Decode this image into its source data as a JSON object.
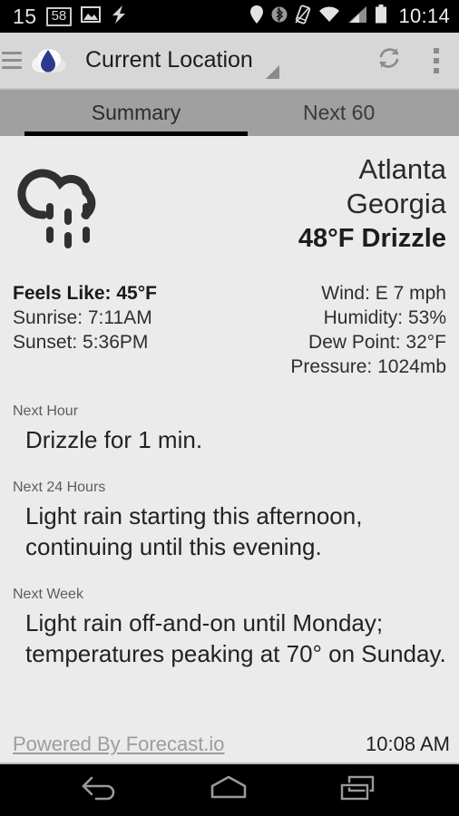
{
  "status_bar": {
    "left_number": "15",
    "boxed_number": "58",
    "icons": [
      "image-icon",
      "lightning-bolt-icon"
    ],
    "right_icons": [
      "location-pin-icon",
      "bluetooth-icon",
      "vibrate-icon",
      "wifi-icon",
      "cellular-signal-icon",
      "battery-icon"
    ],
    "clock": "10:14"
  },
  "action_bar": {
    "menu_icon": "hamburger-icon",
    "app_icon": "cloud-droplet-icon",
    "title": "Current Location",
    "dropdown_icon": "dropdown-triangle-icon",
    "refresh_icon": "refresh-icon",
    "overflow_icon": "overflow-menu-icon",
    "accent_color": "#2a3b8f"
  },
  "tabs": [
    {
      "label": "Summary",
      "active": true
    },
    {
      "label": "Next 60",
      "active": false
    }
  ],
  "current": {
    "weather_icon": "drizzle-icon",
    "city": "Atlanta",
    "region": "Georgia",
    "condition": "48°F Drizzle"
  },
  "details": {
    "left": [
      {
        "text": "Feels Like: 45°F",
        "bold": true
      },
      {
        "text": "Sunrise: 7:11AM",
        "bold": false
      },
      {
        "text": "Sunset: 5:36PM",
        "bold": false
      }
    ],
    "right": [
      {
        "text": "Wind: E 7 mph"
      },
      {
        "text": "Humidity: 53%"
      },
      {
        "text": "Dew Point: 32°F"
      },
      {
        "text": "Pressure: 1024mb"
      }
    ]
  },
  "forecast_sections": [
    {
      "label": "Next Hour",
      "text": "Drizzle for 1 min."
    },
    {
      "label": "Next 24 Hours",
      "text": "Light rain starting this afternoon, continuing until this evening."
    },
    {
      "label": "Next Week",
      "text": "Light rain off-and-on until Monday; temperatures peaking at 70° on Sunday."
    }
  ],
  "footer": {
    "attribution": "Powered By Forecast.io",
    "updated_time": "10:08 AM"
  },
  "nav_bar": {
    "back_icon": "back-arrow-icon",
    "home_icon": "home-icon",
    "recents_icon": "recent-apps-icon"
  }
}
